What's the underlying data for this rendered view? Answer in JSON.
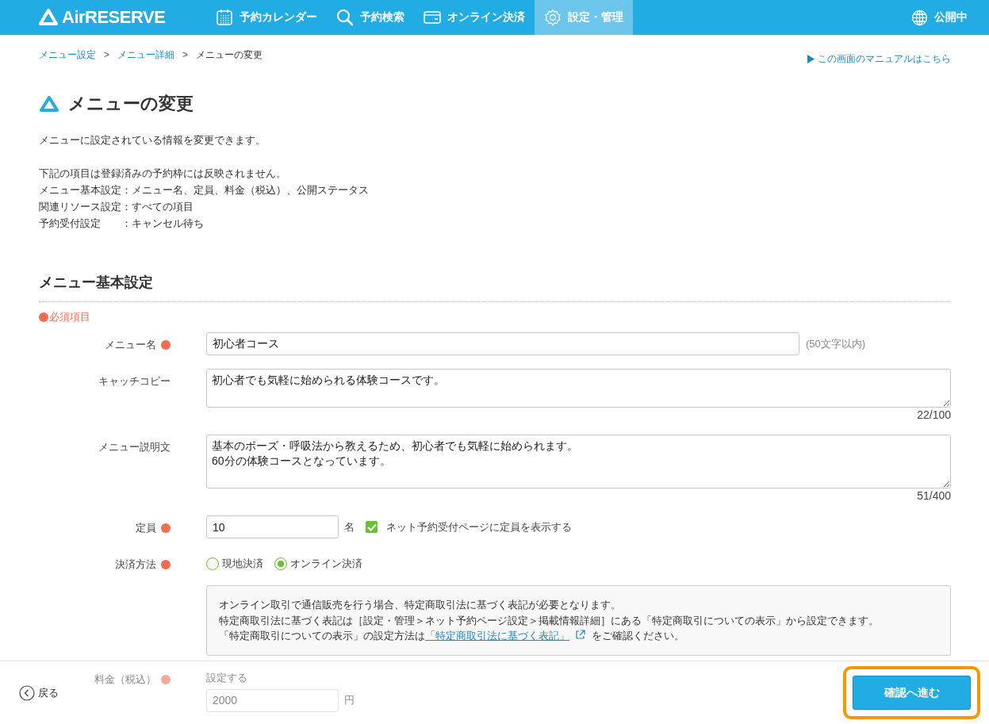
{
  "header": {
    "logo": "AirRESERVE",
    "nav": [
      {
        "label": "予約カレンダー",
        "kind": "calendar",
        "selected": false
      },
      {
        "label": "予約検索",
        "kind": "search",
        "selected": false
      },
      {
        "label": "オンライン決済",
        "kind": "wallet",
        "selected": false
      },
      {
        "label": "設定・管理",
        "kind": "gear",
        "selected": true
      }
    ],
    "status": "公開中"
  },
  "breadcrumb_separator": ">",
  "breadcrumbs": [
    {
      "label": "メニュー設定",
      "kind": "link"
    },
    {
      "label": "メニュー詳細",
      "kind": "link"
    },
    {
      "label": "メニューの変更",
      "kind": "current"
    }
  ],
  "manual_link": "この画面のマニュアルはこちら",
  "title": "メニューの変更",
  "intro": "メニューに設定されている情報を変更できます。",
  "notes_heading": "下記の項目は登録済みの予約枠には反映されません。",
  "notes": [
    {
      "label": "メニュー基本設定",
      "value": "：メニュー名、定員、料金（税込）、公開ステータス"
    },
    {
      "label": "関連リソース設定",
      "value": "：すべての項目"
    },
    {
      "label": "予約受付設定",
      "value": "：キャンセル待ち"
    }
  ],
  "section_title": "メニュー基本設定",
  "required_legend": "必須項目",
  "fields": [
    {
      "kind": "text",
      "label": "メニュー名",
      "required": true,
      "value": "初心者コース",
      "hint": "(50文字以内)"
    },
    {
      "kind": "textarea",
      "label": "キャッチコピー",
      "required": false,
      "value": "初心者でも気軽に始められる体験コースです。",
      "counter": "22/100"
    },
    {
      "kind": "textarea",
      "label": "メニュー説明文",
      "required": false,
      "value": "基本のポーズ・呼吸法から教えるため、初心者でも気軽に始められます。\n60分の体験コースとなっています。",
      "counter": "51/400"
    },
    {
      "kind": "capacity",
      "label": "定員",
      "required": true,
      "value": "10",
      "unit": "名",
      "checkbox": {
        "label": "ネット予約受付ページに定員を表示する",
        "checked": true
      }
    },
    {
      "kind": "radio",
      "label": "決済方法",
      "required": true,
      "options": [
        {
          "label": "現地決済",
          "selected": false
        },
        {
          "label": "オンライン決済",
          "selected": true
        }
      ],
      "notice": {
        "lines": [
          "オンライン取引で通信販売を行う場合、特定商取引法に基づく表記が必要となります。",
          "特定商取引法に基づく表記は［設定・管理＞ネット予約ページ設定＞掲載情報詳細］にある「特定商取引についての表示」から設定できます。"
        ],
        "link_before": "「特定商取引についての表示」の設定方法は",
        "link": "「特定商取引法に基づく表記」",
        "link_after": "をご確認ください。"
      }
    },
    {
      "kind": "price",
      "label": "料金（税込）",
      "required": true,
      "option": "設定する",
      "value": "2000",
      "unit": "円"
    }
  ],
  "footer": {
    "back": "戻る",
    "confirm": "確認へ進む",
    "highlighted": true
  }
}
